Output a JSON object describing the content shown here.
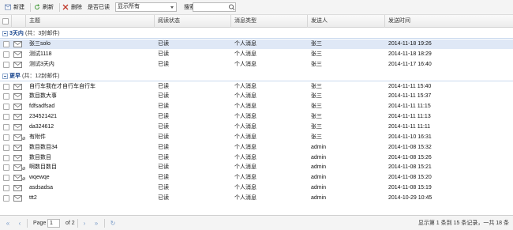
{
  "toolbar": {
    "new_label": "新建",
    "refresh_label": "刷新",
    "delete_label": "删除",
    "filter_label": "是否已读",
    "filter_selected": "显示所有",
    "search_label": "搜索发件人:",
    "search_value": ""
  },
  "columns": {
    "subject": "主题",
    "read_status": "阅读状态",
    "msg_type": "消息类型",
    "sender": "发送人",
    "send_time": "发送时间"
  },
  "groups": [
    {
      "name": "3天内",
      "count": "(共：3封邮件)",
      "rows": [
        {
          "subject": "张三solo",
          "status": "已读",
          "type": "个人消息",
          "sender": "张三",
          "time": "2014-11-18 19:26",
          "attach": false,
          "selected": true
        },
        {
          "subject": "测试1118",
          "status": "已读",
          "type": "个人消息",
          "sender": "张三",
          "time": "2014-11-18 18:29",
          "attach": false,
          "selected": false
        },
        {
          "subject": "测试3天内",
          "status": "已读",
          "type": "个人消息",
          "sender": "张三",
          "time": "2014-11-17 16:40",
          "attach": false,
          "selected": false
        }
      ]
    },
    {
      "name": "更早",
      "count": "(共：12封邮件)",
      "rows": [
        {
          "subject": "自行车我在才自行车自行车",
          "status": "已读",
          "type": "个人消息",
          "sender": "张三",
          "time": "2014-11-11 15:40",
          "attach": false,
          "selected": false
        },
        {
          "subject": "数目数大事",
          "status": "已读",
          "type": "个人消息",
          "sender": "张三",
          "time": "2014-11-11 15:37",
          "attach": false,
          "selected": false
        },
        {
          "subject": "fdfsadfsad",
          "status": "已读",
          "type": "个人消息",
          "sender": "张三",
          "time": "2014-11-11 11:15",
          "attach": false,
          "selected": false
        },
        {
          "subject": "234521421",
          "status": "已读",
          "type": "个人消息",
          "sender": "张三",
          "time": "2014-11-11 11:13",
          "attach": false,
          "selected": false
        },
        {
          "subject": "da324612",
          "status": "已读",
          "type": "个人消息",
          "sender": "张三",
          "time": "2014-11-11 11:11",
          "attach": false,
          "selected": false
        },
        {
          "subject": "有附件",
          "status": "已读",
          "type": "个人消息",
          "sender": "张三",
          "time": "2014-11-10 16:31",
          "attach": true,
          "selected": false
        },
        {
          "subject": "数目数目34",
          "status": "已读",
          "type": "个人消息",
          "sender": "admin",
          "time": "2014-11-08 15:32",
          "attach": false,
          "selected": false
        },
        {
          "subject": "数目数目",
          "status": "已读",
          "type": "个人消息",
          "sender": "admin",
          "time": "2014-11-08 15:26",
          "attach": false,
          "selected": false
        },
        {
          "subject": "啊数目数目",
          "status": "已读",
          "type": "个人消息",
          "sender": "admin",
          "time": "2014-11-08 15:21",
          "attach": true,
          "selected": false
        },
        {
          "subject": "wqewqe",
          "status": "已读",
          "type": "个人消息",
          "sender": "admin",
          "time": "2014-11-08 15:20",
          "attach": true,
          "selected": false
        },
        {
          "subject": "asdsadsa",
          "status": "已读",
          "type": "个人消息",
          "sender": "admin",
          "time": "2014-11-08 15:19",
          "attach": false,
          "selected": false
        },
        {
          "subject": "ttt2",
          "status": "已读",
          "type": "个人消息",
          "sender": "admin",
          "time": "2014-10-29 10:45",
          "attach": false,
          "selected": false
        }
      ]
    }
  ],
  "pager": {
    "page_label": "Page",
    "page_value": "1",
    "of_label": "of 2",
    "info": "显示第 1 条到 15 条记录，一共 18 条"
  },
  "colors": {
    "group_text": "#15428b",
    "selected_row": "#dfe8f6",
    "pager_icon": "#7a9cc8"
  }
}
